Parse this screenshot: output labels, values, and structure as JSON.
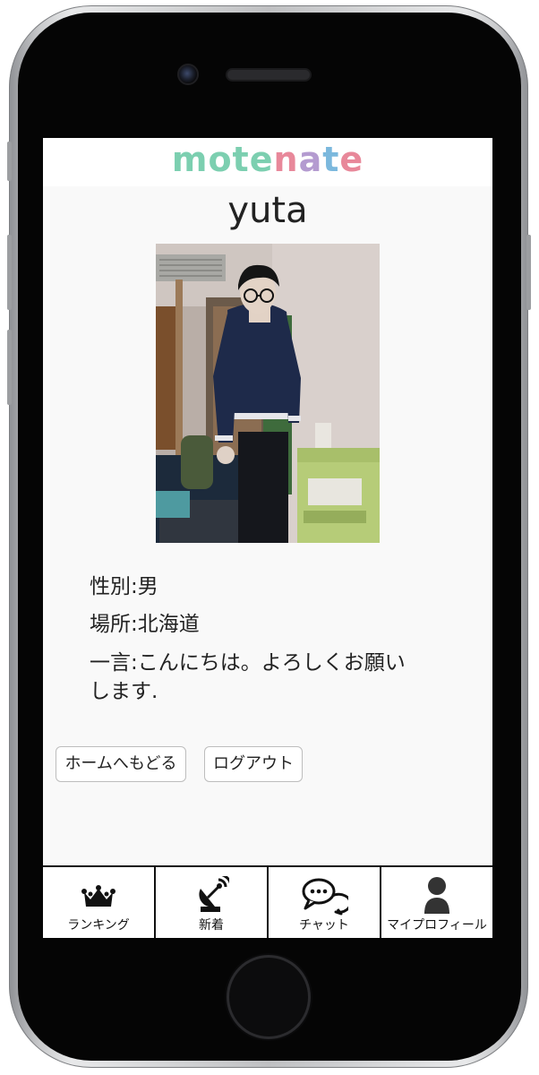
{
  "app": {
    "logo_letters": [
      {
        "char": "m",
        "color": "#7ccfb0"
      },
      {
        "char": "o",
        "color": "#7ccfb0"
      },
      {
        "char": "t",
        "color": "#7ccfb0"
      },
      {
        "char": "e",
        "color": "#7ccfb0"
      },
      {
        "char": "n",
        "color": "#e8889a"
      },
      {
        "char": "a",
        "color": "#b49bd0"
      },
      {
        "char": "t",
        "color": "#7bb8dd"
      },
      {
        "char": "e",
        "color": "#e8889a"
      }
    ]
  },
  "profile": {
    "name": "yuta",
    "gender": "性別:男",
    "location": "場所:北海道",
    "message_line1": "一言:こんにちは。よろしくお願い",
    "message_line2": "します."
  },
  "buttons": {
    "home": "ホームへもどる",
    "logout": "ログアウト"
  },
  "tabs": [
    {
      "label": "ランキング",
      "icon": "crown-icon"
    },
    {
      "label": "新着",
      "icon": "satellite-dish-icon"
    },
    {
      "label": "チャット",
      "icon": "chat-bubbles-icon"
    },
    {
      "label": "マイプロフィール",
      "icon": "person-icon"
    }
  ]
}
